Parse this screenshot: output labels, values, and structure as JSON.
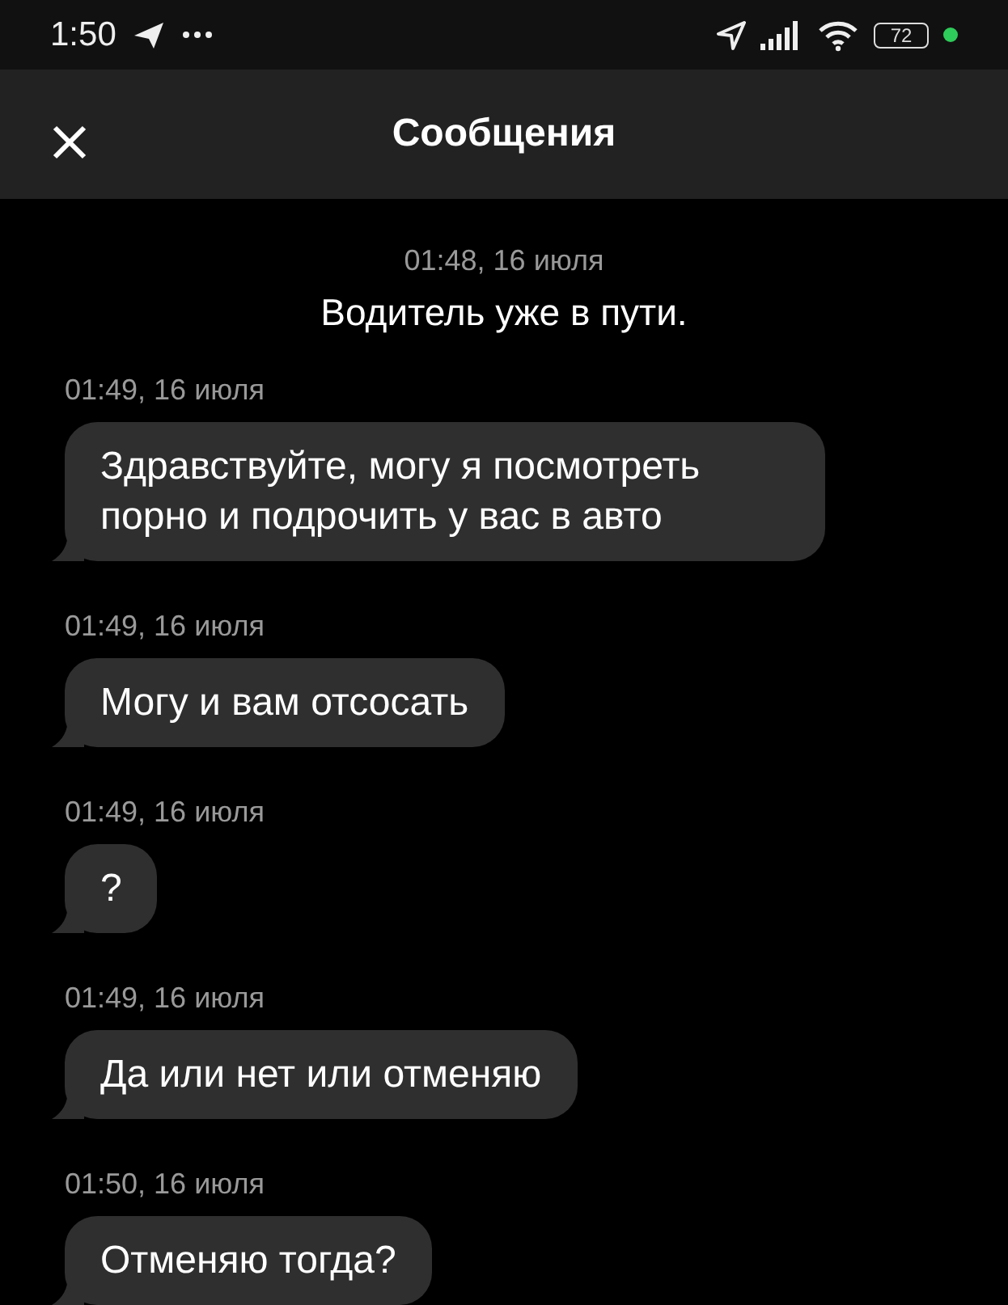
{
  "status_bar": {
    "time": "1:50",
    "battery": "72"
  },
  "header": {
    "title": "Сообщения"
  },
  "system_message": {
    "time": "01:48, 16 июля",
    "text": "Водитель уже в пути."
  },
  "messages": [
    {
      "time": "01:49, 16 июля",
      "text": "Здравствуйте, могу я посмотреть порно и подрочить у вас в авто"
    },
    {
      "time": "01:49, 16 июля",
      "text": "Могу и вам отсосать"
    },
    {
      "time": "01:49, 16 июля",
      "text": "?"
    },
    {
      "time": "01:49, 16 июля",
      "text": "Да или нет или отменяю"
    },
    {
      "time": "01:50, 16 июля",
      "text": "Отменяю тогда?"
    }
  ]
}
